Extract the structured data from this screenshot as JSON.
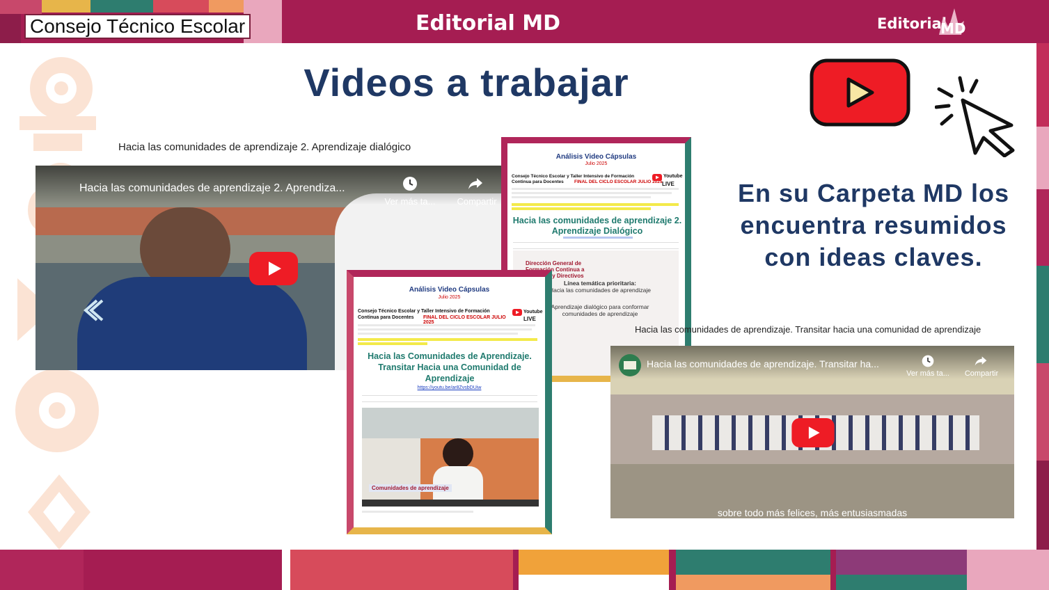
{
  "header": {
    "label": "Consejo Técnico Escolar",
    "center_title": "Editorial MD",
    "logo_text": "Editorial"
  },
  "title": "Videos a trabajar",
  "side_text": "En su Carpeta MD los encuentra resumidos con ideas claves.",
  "video1": {
    "caption": "Hacia las comunidades de aprendizaje 2. Aprendizaje dialógico",
    "player_title": "Hacia las comunidades de aprendizaje 2. Aprendiza...",
    "watch_later": "Ver más ta...",
    "share": "Compartir"
  },
  "video2": {
    "caption": "Hacia las comunidades de aprendizaje. Transitar hacia una comunidad de aprendizaje",
    "player_title": "Hacia las comunidades de aprendizaje. Transitar ha...",
    "watch_later": "Ver más ta...",
    "share": "Compartir",
    "subtitle": "sobre todo más felices, más entusiasmadas"
  },
  "doc1": {
    "heading": "Análisis Video Cápsulas",
    "date": "Julio 2025",
    "intro_line1": "Consejo Técnico Escolar y Taller Intensivo de Formación",
    "intro_line2a": "Continua para Docentes",
    "intro_line2b": "FINAL DEL CICLO ESCOLAR JULIO 2025",
    "title": "Hacia las comunidades de aprendizaje 2. Aprendizaje Dialógico",
    "yt_word": "Youtube",
    "live_word": "LIVE",
    "slide_org": "Dirección General de Formación Continua a Docentes y Directivos",
    "slide_line1": "Línea temática prioritaria:",
    "slide_line2": "Hacia las comunidades de aprendizaje",
    "slide_line3": "Aprendizaje dialógico para conformar comunidades de aprendizaje"
  },
  "doc2": {
    "heading": "Análisis Video Cápsulas",
    "date": "Julio 2025",
    "intro_line1": "Consejo Técnico Escolar y Taller Intensivo de Formación",
    "intro_line2a": "Continua para Docentes",
    "intro_line2b": "FINAL DEL CICLO ESCOLAR JULIO 2025",
    "title": "Hacia las Comunidades de Aprendizaje. Transitar Hacia una Comunidad de Aprendizaje",
    "link": "https://youtu.be/ar8ZvsbDUiw",
    "yt_word": "Youtube",
    "live_word": "LIVE",
    "video_label": "Comunidades de aprendizaje"
  },
  "colors": {
    "brand_magenta": "#a51d52",
    "title_navy": "#1f3864",
    "youtube_red": "#ee1c25"
  }
}
